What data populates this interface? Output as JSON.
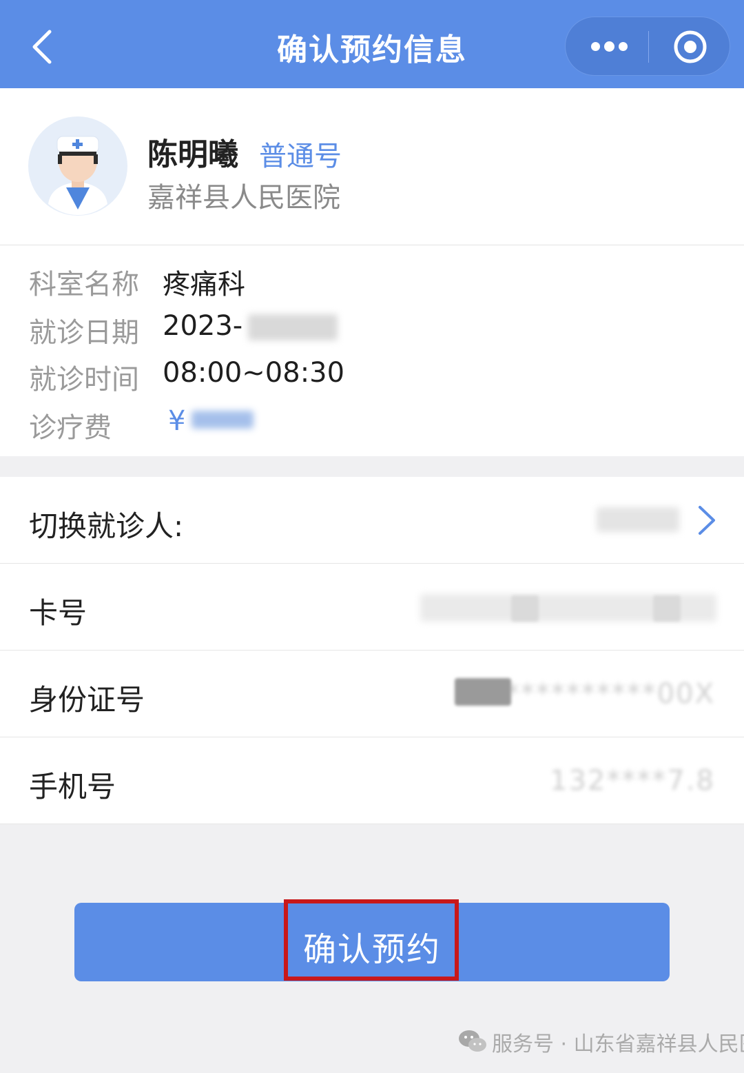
{
  "nav": {
    "title": "确认预约信息",
    "back_icon": "chevron-left-icon",
    "more_icon": "more-dots-icon",
    "close_icon": "target-circle-icon",
    "color": "#5b8de6"
  },
  "doctor": {
    "name": "陈明曦",
    "type": "普通号",
    "hospital": "嘉祥县人民医院",
    "avatar_icon": "doctor-avatar-icon"
  },
  "info": {
    "department_label": "科室名称",
    "department_value": "疼痛科",
    "date_label": "就诊日期",
    "date_value": "2023-",
    "time_label": "就诊时间",
    "time_value": "08:00~08:30",
    "fee_label": "诊疗费",
    "fee_value": "¥"
  },
  "form": {
    "switch_label": "切换就诊人:",
    "card_label": "卡号",
    "id_label": "身份证号",
    "id_value": "**********00X",
    "phone_label": "手机号",
    "phone_value": "132****7.8",
    "chevron_icon": "chevron-right-icon"
  },
  "actions": {
    "confirm_label": "确认预约",
    "highlight_color": "#c8181a"
  },
  "watermark": {
    "text": "服务号 · 山东省嘉祥县人民医院",
    "icon": "wechat-icon"
  }
}
